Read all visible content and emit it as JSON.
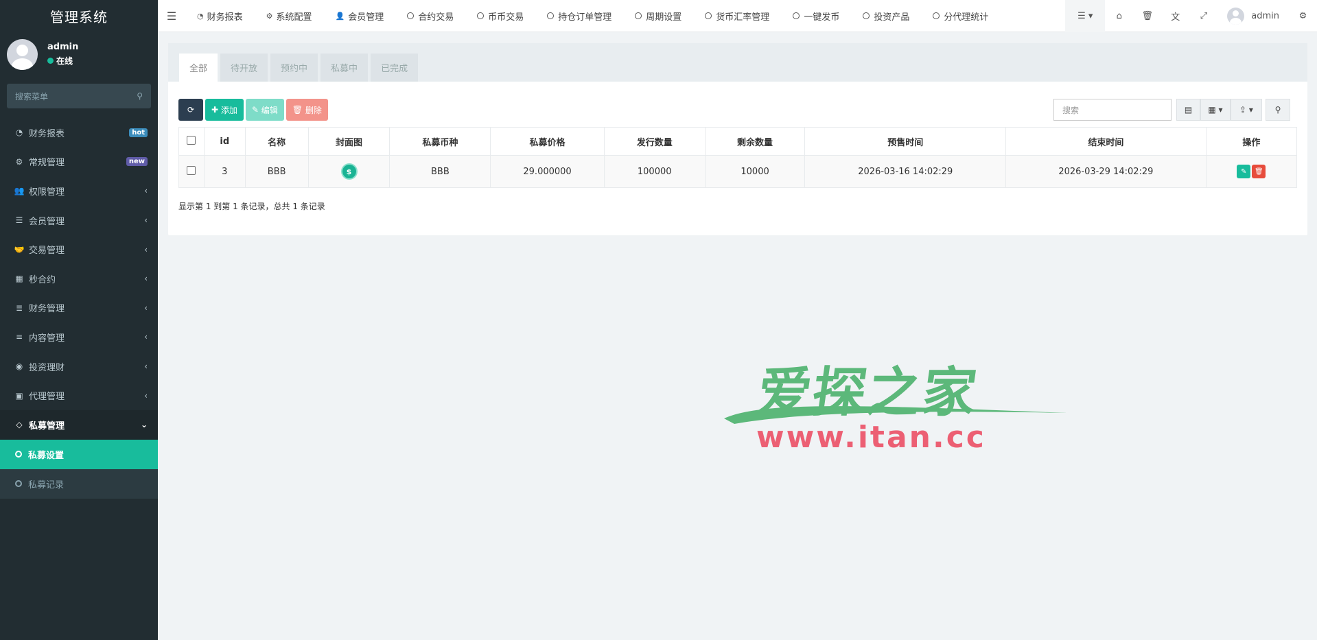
{
  "app": {
    "title": "管理系统"
  },
  "user": {
    "name": "admin",
    "status": "在线"
  },
  "sidebar": {
    "search_placeholder": "搜索菜单",
    "items": [
      {
        "label": "财务报表",
        "icon": "dashboard-icon",
        "badge": "hot"
      },
      {
        "label": "常规管理",
        "icon": "cogs-icon",
        "badge": "new"
      },
      {
        "label": "权限管理",
        "icon": "users-icon"
      },
      {
        "label": "会员管理",
        "icon": "list-icon"
      },
      {
        "label": "交易管理",
        "icon": "handshake-icon"
      },
      {
        "label": "秒合约",
        "icon": "calendar-icon"
      },
      {
        "label": "财务管理",
        "icon": "database-icon"
      },
      {
        "label": "内容管理",
        "icon": "align-left-icon"
      },
      {
        "label": "投资理财",
        "icon": "compass-icon"
      },
      {
        "label": "代理管理",
        "icon": "briefcase-icon"
      },
      {
        "label": "私募管理",
        "icon": "diamond-icon",
        "open": true
      }
    ],
    "subitems": [
      {
        "label": "私募设置",
        "active": true
      },
      {
        "label": "私募记录"
      }
    ]
  },
  "topnav": {
    "links": [
      {
        "label": "财务报表",
        "icon": "dashboard-icon"
      },
      {
        "label": "系统配置",
        "icon": "gear-icon"
      },
      {
        "label": "会员管理",
        "icon": "user-icon"
      },
      {
        "label": "合约交易",
        "icon": "circle-icon"
      },
      {
        "label": "币币交易",
        "icon": "circle-icon"
      },
      {
        "label": "持仓订单管理",
        "icon": "circle-icon"
      },
      {
        "label": "周期设置",
        "icon": "circle-icon"
      },
      {
        "label": "货币汇率管理",
        "icon": "circle-icon"
      },
      {
        "label": "一键发币",
        "icon": "circle-icon"
      },
      {
        "label": "投资产品",
        "icon": "circle-icon"
      },
      {
        "label": "分代理统计",
        "icon": "circle-icon"
      }
    ],
    "user_name": "admin"
  },
  "tabs": [
    "全部",
    "待开放",
    "预约中",
    "私募中",
    "已完成"
  ],
  "toolbar": {
    "add": "添加",
    "edit": "编辑",
    "delete": "删除",
    "search_placeholder": "搜索"
  },
  "table": {
    "columns": [
      "id",
      "名称",
      "封面图",
      "私募币种",
      "私募价格",
      "发行数量",
      "剩余数量",
      "预售时间",
      "结束时间",
      "操作"
    ],
    "rows": [
      {
        "id": "3",
        "name": "BBB",
        "coin": "BBB",
        "price": "29.000000",
        "issue": "100000",
        "remain": "10000",
        "presale": "2026-03-16 14:02:29",
        "end": "2026-03-29 14:02:29"
      }
    ]
  },
  "pager": "显示第 1 到第 1 条记录，总共 1 条记录",
  "watermark": {
    "cn": "爱探之家",
    "url": "www.itan.cc"
  },
  "colors": {
    "sidebar": "#222d32",
    "accent": "#18bc9c",
    "danger": "#e74c3c"
  }
}
